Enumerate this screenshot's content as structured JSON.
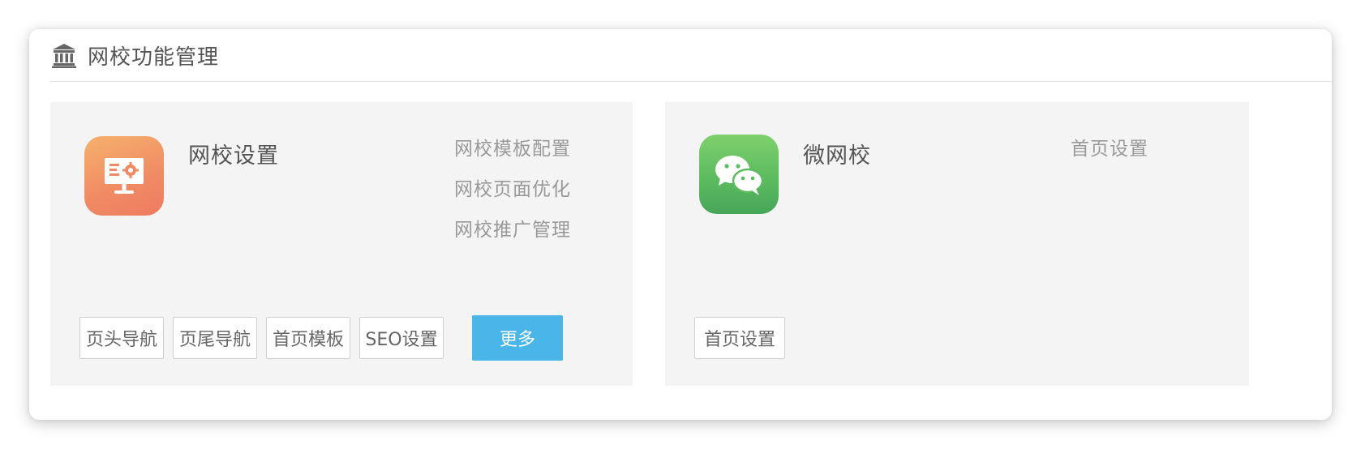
{
  "header": {
    "title": "网校功能管理",
    "icon": "bank-icon"
  },
  "cards": [
    {
      "title": "网校设置",
      "icon": "presentation-settings-icon",
      "icon_color": "#f08a64",
      "links": [
        "网校模板配置",
        "网校页面优化",
        "网校推广管理"
      ],
      "buttons": [
        "页头导航",
        "页尾导航",
        "首页模板",
        "SEO设置"
      ],
      "more_label": "更多"
    },
    {
      "title": "微网校",
      "icon": "wechat-icon",
      "icon_color": "#5dbb60",
      "links": [
        "首页设置"
      ],
      "buttons": [
        "首页设置"
      ]
    }
  ],
  "colors": {
    "primary": "#4ab5e8",
    "card_bg": "#f4f4f4",
    "link_text": "#999999"
  }
}
